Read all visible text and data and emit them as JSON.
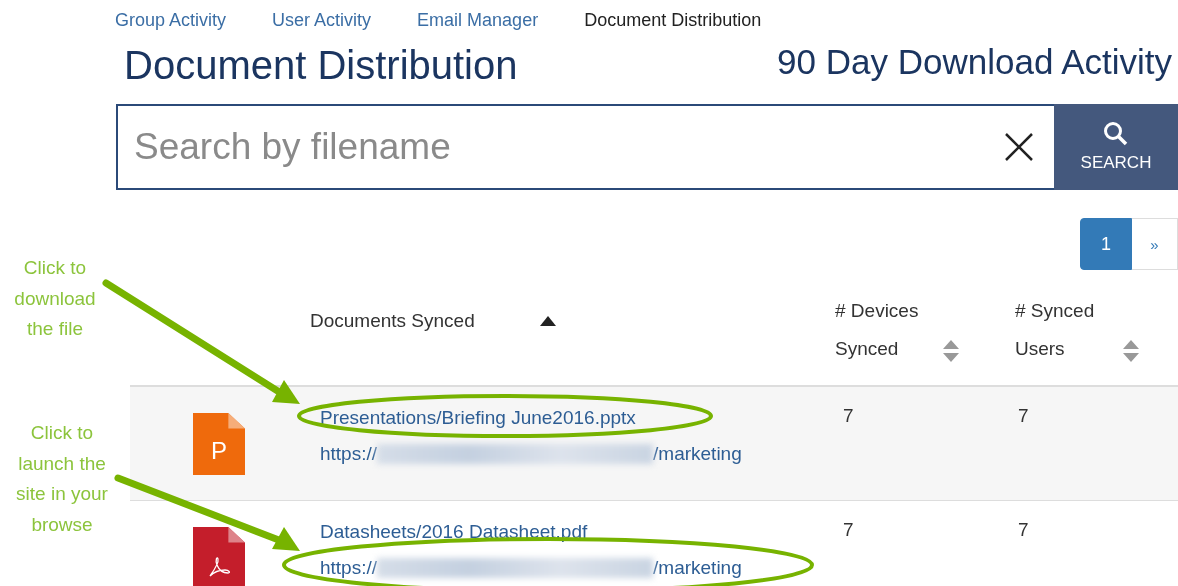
{
  "nav": [
    {
      "label": "Group Activity",
      "selected": false
    },
    {
      "label": "User Activity",
      "selected": false
    },
    {
      "label": "Email Manager",
      "selected": false
    },
    {
      "label": "Document Distribution",
      "selected": true
    }
  ],
  "title": "Document Distribution",
  "subtitle": "90 Day Download Activity",
  "search": {
    "placeholder": "Search by filename",
    "button_label": "SEARCH"
  },
  "pagination": {
    "pages": [
      {
        "label": "1",
        "selected": true
      }
    ],
    "next": "»"
  },
  "table": {
    "columns": [
      {
        "label": "Documents Synced",
        "sorted": true
      },
      {
        "label": "# Devices Synced",
        "sorted": false
      },
      {
        "label": "# Synced Users",
        "sorted": false
      }
    ],
    "rows": [
      {
        "kind": "pptx",
        "icon_letter": "P",
        "name": "Presentations/Briefing June2016.pptx",
        "url_prefix": "https://",
        "url_suffix": "/marketing",
        "devices": "7",
        "users": "7"
      },
      {
        "kind": "pdf",
        "name": "Datasheets/2016 Datasheet.pdf",
        "url_prefix": "https://",
        "url_suffix": "/marketing",
        "devices": "7",
        "users": "7"
      }
    ]
  },
  "annotations": [
    {
      "text": "Click to\ndownload\nthe file"
    },
    {
      "text": "Click to\nlaunch the\nsite in your\nbrowse"
    }
  ]
}
